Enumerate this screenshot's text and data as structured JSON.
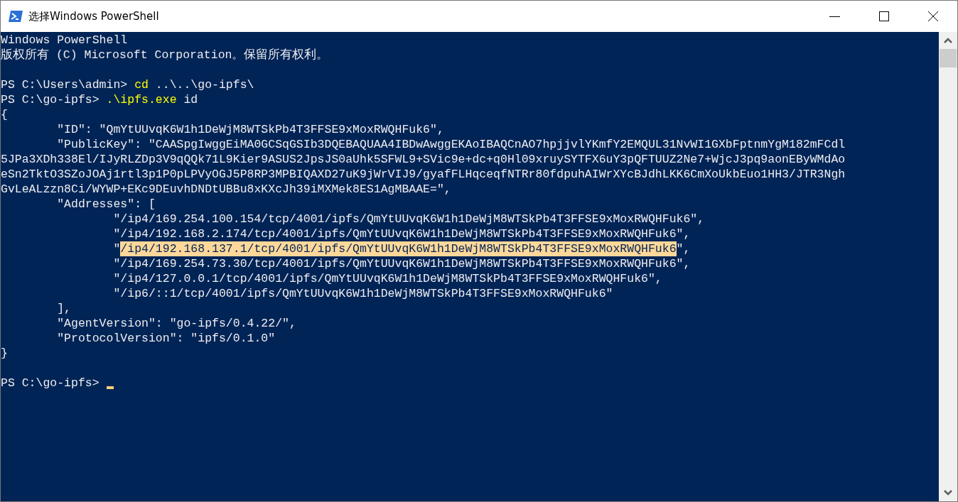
{
  "window": {
    "title": "选择Windows PowerShell"
  },
  "terminal": {
    "lines": [
      {
        "segments": [
          {
            "kind": "output",
            "text": "Windows PowerShell"
          }
        ]
      },
      {
        "segments": [
          {
            "kind": "output",
            "text": "版权所有 (C) Microsoft Corporation。保留所有权利。"
          }
        ]
      },
      {
        "kind": "blank"
      },
      {
        "segments": [
          {
            "kind": "prompt",
            "text": "PS C:\\Users\\admin> "
          },
          {
            "kind": "command",
            "text": "cd"
          },
          {
            "kind": "argument",
            "text": " ..\\..\\go-ipfs\\"
          }
        ]
      },
      {
        "segments": [
          {
            "kind": "prompt",
            "text": "PS C:\\go-ipfs> "
          },
          {
            "kind": "command",
            "text": ".\\ipfs.exe"
          },
          {
            "kind": "argument",
            "text": " id"
          }
        ]
      },
      {
        "segments": [
          {
            "kind": "output",
            "text": "{"
          }
        ]
      },
      {
        "segments": [
          {
            "kind": "output",
            "text": "        \"ID\": \"QmYtUUvqK6W1h1DeWjM8WTSkPb4T3FFSE9xMoxRWQHFuk6\","
          }
        ]
      },
      {
        "segments": [
          {
            "kind": "output",
            "text": "        \"PublicKey\": \"CAASpgIwggEiMA0GCSqGSIb3DQEBAQUAA4IBDwAwggEKAoIBAQCnAO7hpjjvlYKmfY2EMQUL31NvWI1GXbFptnmYgM182mFCdl"
          }
        ]
      },
      {
        "segments": [
          {
            "kind": "output",
            "text": "5JPa3XDh338El/IJyRLZDp3V9qQQk71L9Kier9ASUS2JpsJS0aUhk5SFWL9+SVic9e+dc+q0Hl09xruySYTFX6uY3pQFTUUZ2Ne7+WjcJ3pq9aonEByWMdAo"
          }
        ]
      },
      {
        "segments": [
          {
            "kind": "output",
            "text": "eSn2TktO3SZoJOAj1rtl3p1P0pLPVyOGJ5P8RP3MPBIQAXD27uK9jWrVIJ9/gyafFLHqceqfNTRr80fdpuhAIWrXYcBJdhLKK6CmXoUkbEuo1HH3/JTR3Ngh"
          }
        ]
      },
      {
        "segments": [
          {
            "kind": "output",
            "text": "GvLeALzzn8Ci/WYWP+EKc9DEuvhDNDtUBBu8xKXcJh39iMXMek8ES1AgMBAAE=\","
          }
        ]
      },
      {
        "segments": [
          {
            "kind": "output",
            "text": "        \"Addresses\": ["
          }
        ]
      },
      {
        "segments": [
          {
            "kind": "output",
            "text": "                \"/ip4/169.254.100.154/tcp/4001/ipfs/QmYtUUvqK6W1h1DeWjM8WTSkPb4T3FFSE9xMoxRWQHFuk6\","
          }
        ]
      },
      {
        "segments": [
          {
            "kind": "output",
            "text": "                \"/ip4/192.168.2.174/tcp/4001/ipfs/QmYtUUvqK6W1h1DeWjM8WTSkPb4T3FFSE9xMoxRWQHFuk6\","
          }
        ]
      },
      {
        "segments": [
          {
            "kind": "output",
            "text": "                \""
          },
          {
            "kind": "selection",
            "text": "/ip4/192.168.137.1/tcp/4001/ipfs/QmYtUUvqK6W1h1DeWjM8WTSkPb4T3FFSE9xMoxRWQHFuk6"
          },
          {
            "kind": "output",
            "text": "\","
          }
        ]
      },
      {
        "segments": [
          {
            "kind": "output",
            "text": "                \"/ip4/169.254.73.30/tcp/4001/ipfs/QmYtUUvqK6W1h1DeWjM8WTSkPb4T3FFSE9xMoxRWQHFuk6\","
          }
        ]
      },
      {
        "segments": [
          {
            "kind": "output",
            "text": "                \"/ip4/127.0.0.1/tcp/4001/ipfs/QmYtUUvqK6W1h1DeWjM8WTSkPb4T3FFSE9xMoxRWQHFuk6\","
          }
        ]
      },
      {
        "segments": [
          {
            "kind": "output",
            "text": "                \"/ip6/::1/tcp/4001/ipfs/QmYtUUvqK6W1h1DeWjM8WTSkPb4T3FFSE9xMoxRWQHFuk6\""
          }
        ]
      },
      {
        "segments": [
          {
            "kind": "output",
            "text": "        ],"
          }
        ]
      },
      {
        "segments": [
          {
            "kind": "output",
            "text": "        \"AgentVersion\": \"go-ipfs/0.4.22/\","
          }
        ]
      },
      {
        "segments": [
          {
            "kind": "output",
            "text": "        \"ProtocolVersion\": \"ipfs/0.1.0\""
          }
        ]
      },
      {
        "segments": [
          {
            "kind": "output",
            "text": "}"
          }
        ]
      },
      {
        "kind": "blank"
      },
      {
        "segments": [
          {
            "kind": "prompt",
            "text": "PS C:\\go-ipfs> "
          },
          {
            "kind": "cursor"
          }
        ]
      }
    ]
  }
}
